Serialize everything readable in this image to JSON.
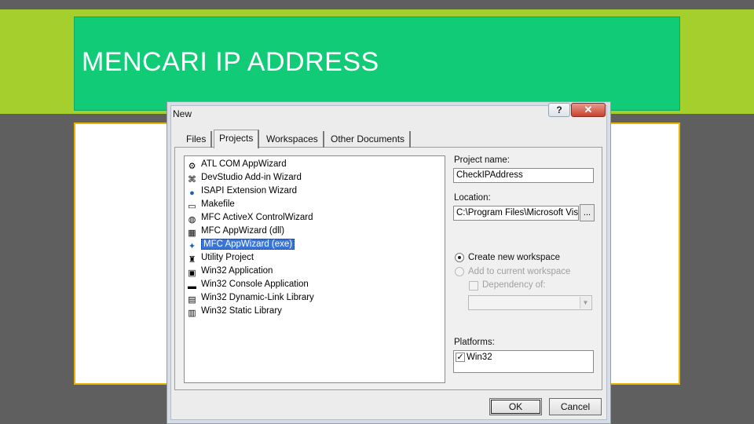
{
  "slide": {
    "title": "MENCARI IP ADDRESS"
  },
  "dialog": {
    "title": "New",
    "help_label": "?",
    "close_label": "✕",
    "tabs": [
      "Files",
      "Projects",
      "Workspaces",
      "Other Documents"
    ],
    "active_tab": "Projects",
    "projects": [
      "ATL COM AppWizard",
      "DevStudio Add-in Wizard",
      "ISAPI Extension Wizard",
      "Makefile",
      "MFC ActiveX ControlWizard",
      "MFC AppWizard (dll)",
      "MFC AppWizard (exe)",
      "Utility Project",
      "Win32 Application",
      "Win32 Console Application",
      "Win32 Dynamic-Link Library",
      "Win32 Static Library"
    ],
    "selected_project": "MFC AppWizard (exe)",
    "project_name_label": "Project name:",
    "project_name_value": "CheckIPAddress",
    "location_label": "Location:",
    "location_value": "C:\\Program Files\\Microsoft Visua",
    "browse_label": "...",
    "create_new_label": "Create new workspace",
    "add_current_label": "Add to current workspace",
    "dependency_label": "Dependency of:",
    "platforms_label": "Platforms:",
    "platform_item": "Win32",
    "ok_label": "OK",
    "cancel_label": "Cancel"
  },
  "colors": {
    "title_green": "#12cb77",
    "band_lime": "#a5cf2c",
    "frame_gold": "#e8b400",
    "selection_blue": "#3875d7"
  }
}
